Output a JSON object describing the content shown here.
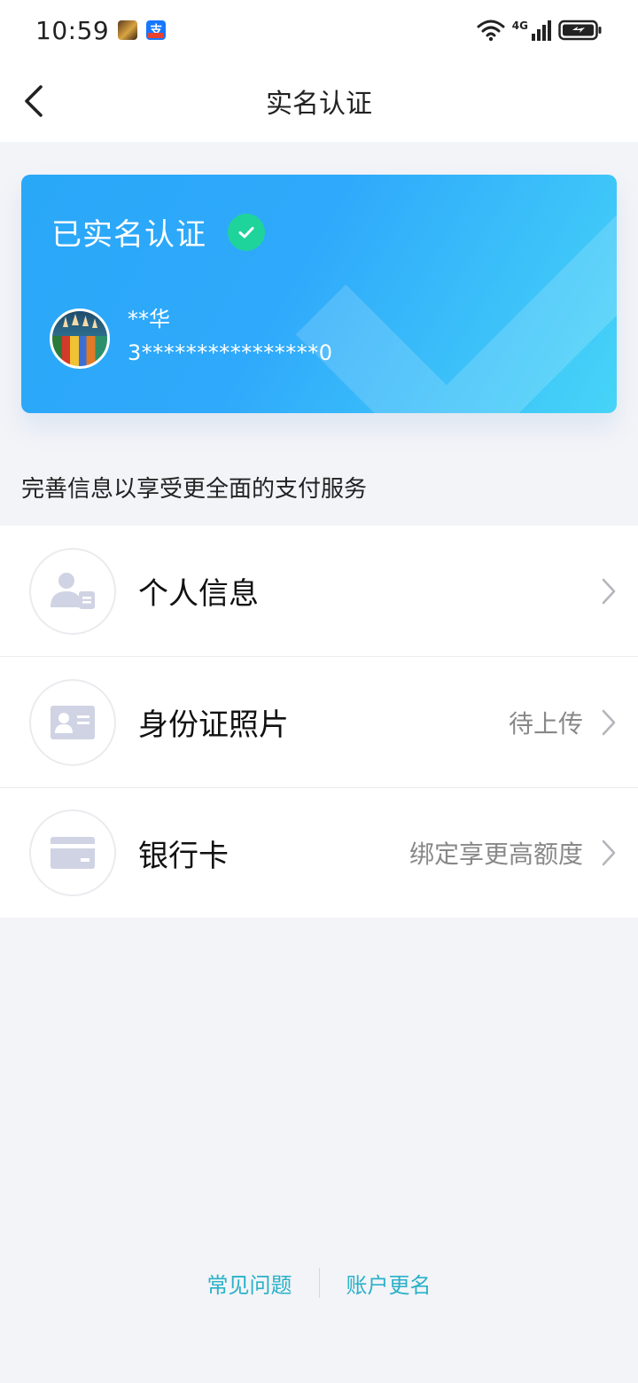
{
  "status_bar": {
    "time": "10:59",
    "network": "4G",
    "icons": [
      "game-app-icon",
      "alipay-app-icon",
      "wifi-icon",
      "signal-icon",
      "battery-icon"
    ]
  },
  "header": {
    "title": "实名认证",
    "back_icon": "chevron-left-icon"
  },
  "card": {
    "title": "已实名认证",
    "name": "**华",
    "id_number": "3****************0",
    "badge_icon": "check-circle-icon",
    "colors": {
      "start": "#2aa8f8",
      "end": "#46d4f7",
      "badge": "#1fd49b"
    }
  },
  "hint": "完善信息以享受更全面的支付服务",
  "list": {
    "items": [
      {
        "label": "个人信息",
        "status": "",
        "icon": "person-card-icon"
      },
      {
        "label": "身份证照片",
        "status": "待上传",
        "icon": "id-card-icon"
      },
      {
        "label": "银行卡",
        "status": "绑定享更高额度",
        "icon": "bank-card-icon"
      }
    ]
  },
  "footer": {
    "faq": "常见问题",
    "rename": "账户更名",
    "link_color": "#2ab1c8"
  }
}
